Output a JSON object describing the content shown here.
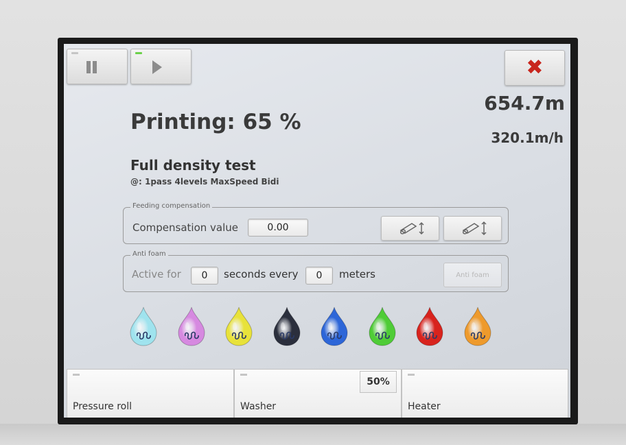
{
  "toolbar": {
    "pause_icon": "pause-icon",
    "play_icon": "play-icon",
    "close_icon": "close-icon",
    "close_color": "#c8261d",
    "play_led_color": "#6cd14a",
    "pause_led_color": "#c5c5c5"
  },
  "job": {
    "status": "Printing: 65 %",
    "progress_percent": 65,
    "meters": "654.7m",
    "speed": "320.1m/h",
    "title": "Full density test",
    "mode": "@: 1pass 4levels MaxSpeed Bidi"
  },
  "feeding_compensation": {
    "legend": "Feeding compensation",
    "label": "Compensation value",
    "value": "0.00",
    "buttons": [
      "feed-roll-decrease-icon",
      "feed-roll-increase-icon"
    ]
  },
  "anti_foam": {
    "legend": "Anti foam",
    "active_for_label": "Active for",
    "seconds_value": "0",
    "seconds_every_label": "seconds every",
    "meters_value": "0",
    "meters_label": "meters",
    "button_label": "Anti foam"
  },
  "inks": [
    {
      "name": "light-cyan-ink-icon",
      "color": "#9fe3ee"
    },
    {
      "name": "light-magenta-ink-icon",
      "color": "#d689e0"
    },
    {
      "name": "yellow-ink-icon",
      "color": "#e8e23a"
    },
    {
      "name": "black-ink-icon",
      "color": "#2b2f3d"
    },
    {
      "name": "cyan-ink-icon",
      "color": "#2d66d8"
    },
    {
      "name": "green-ink-icon",
      "color": "#4fcc37"
    },
    {
      "name": "red-ink-icon",
      "color": "#d8231d"
    },
    {
      "name": "orange-ink-icon",
      "color": "#ee9a2c"
    }
  ],
  "bottom": {
    "pressure_roll": "Pressure roll",
    "washer": "Washer",
    "washer_percent": "50%",
    "heater": "Heater"
  }
}
